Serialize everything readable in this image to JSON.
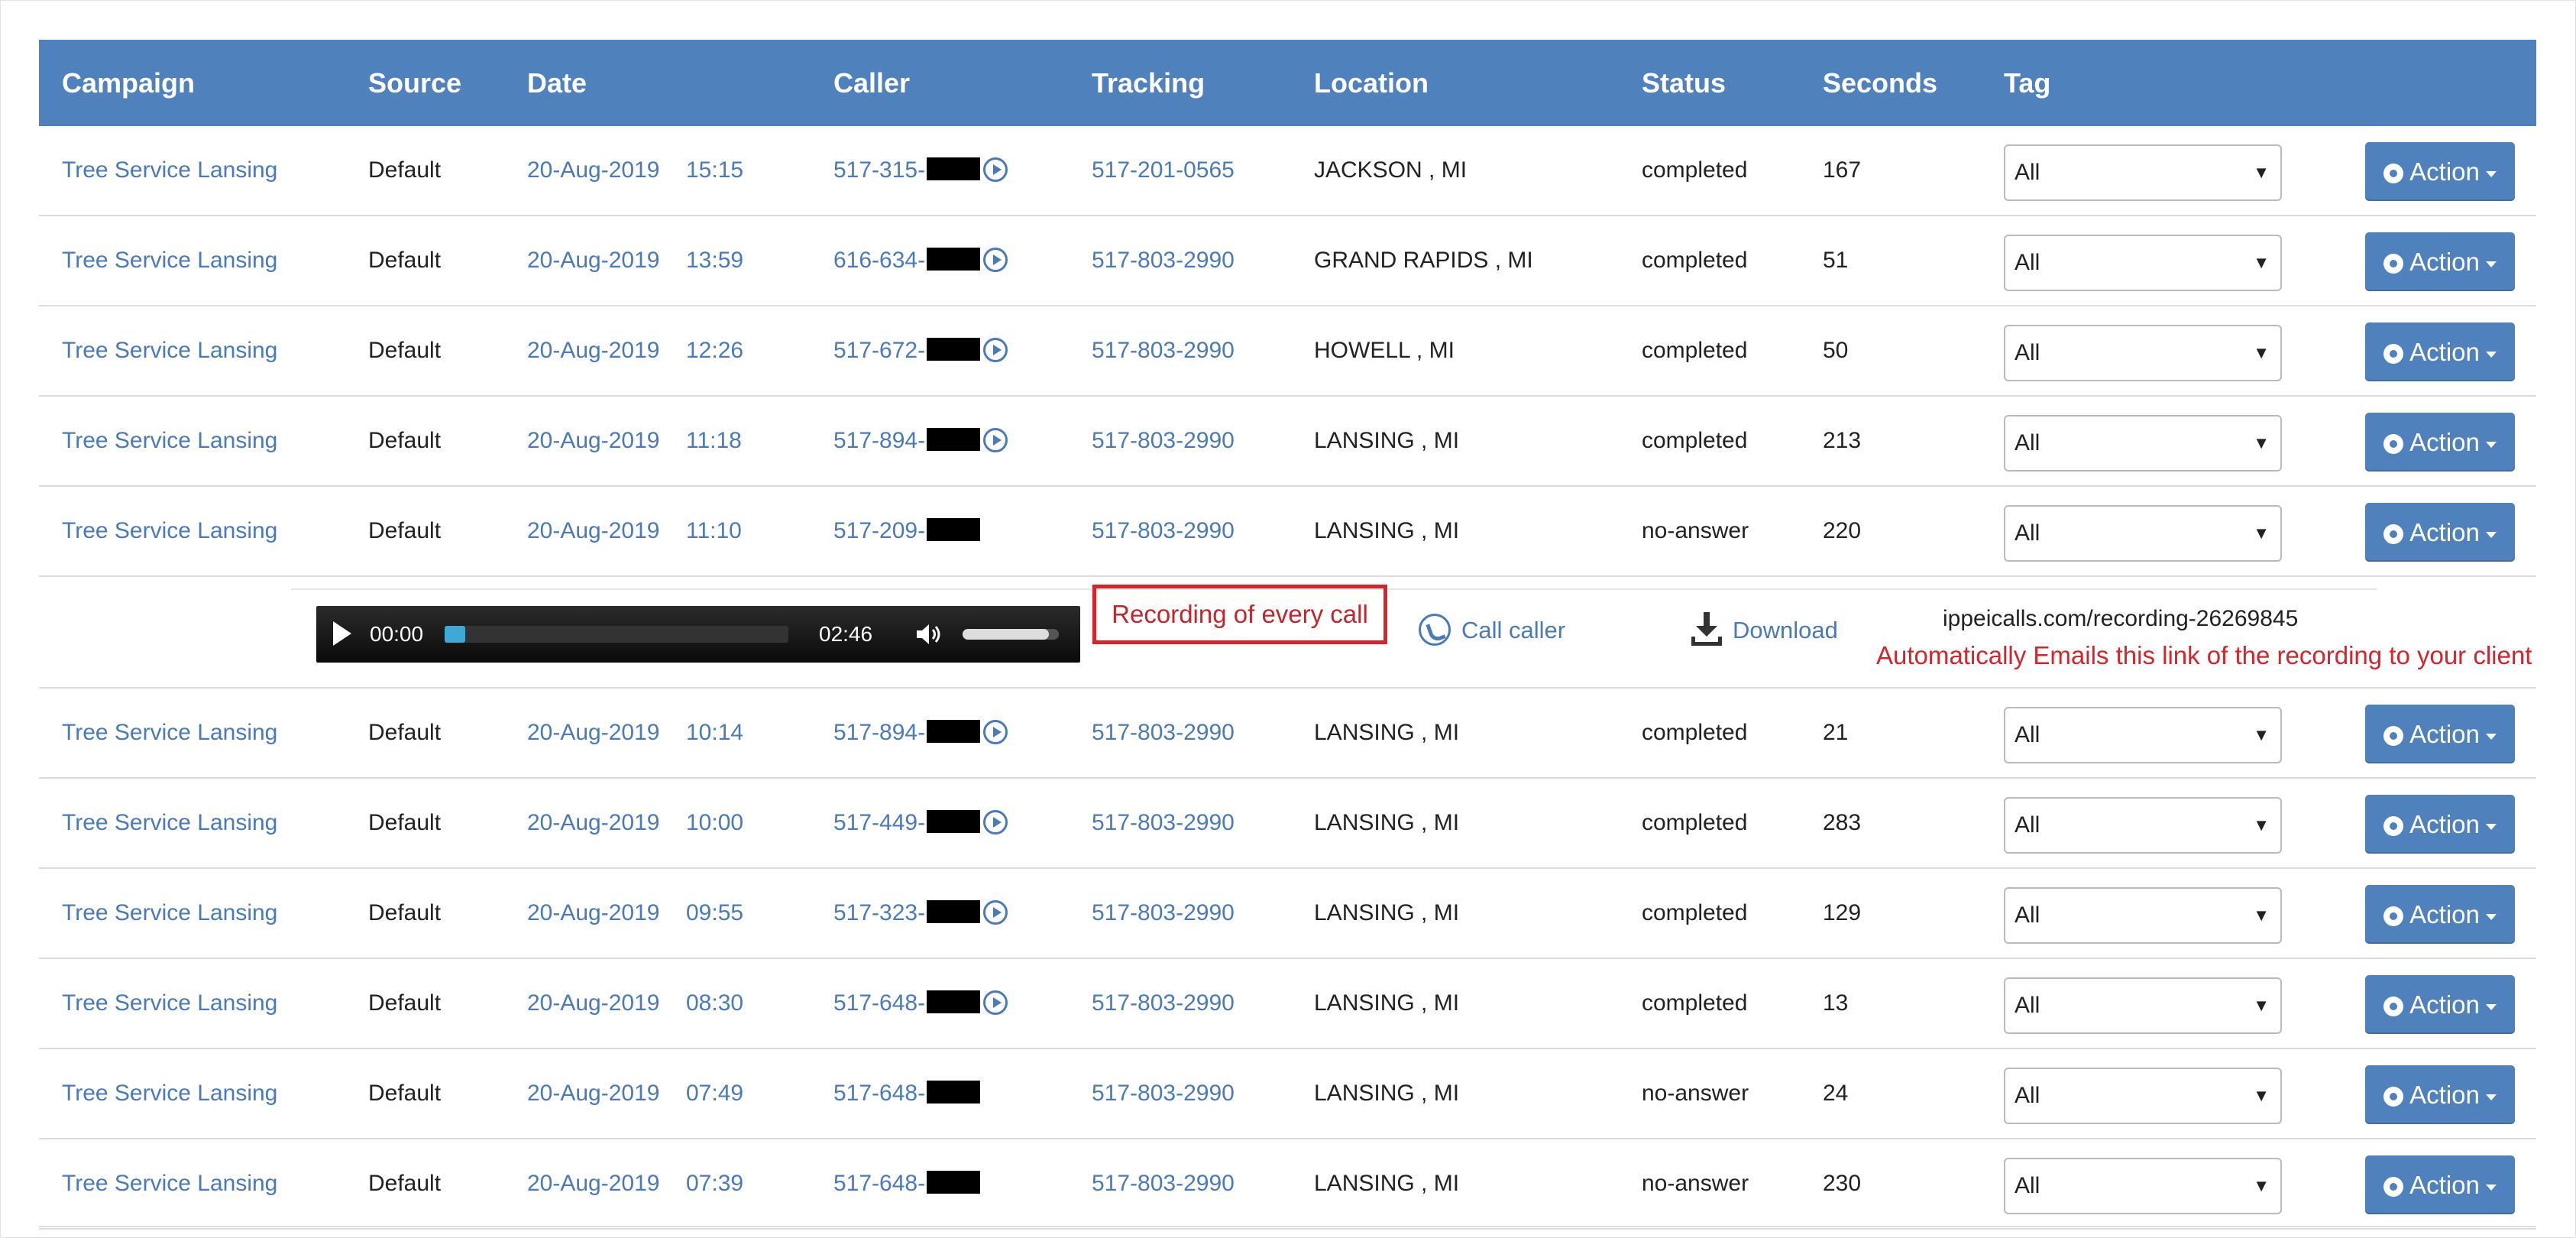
{
  "header": {
    "campaign": "Campaign",
    "source": "Source",
    "date": "Date",
    "caller": "Caller",
    "tracking": "Tracking",
    "location": "Location",
    "status": "Status",
    "seconds": "Seconds",
    "tag": "Tag"
  },
  "rows": [
    {
      "campaign": "Tree Service Lansing",
      "source": "Default",
      "date": "20-Aug-2019",
      "time": "15:15",
      "caller": "517-315-",
      "has_recording": true,
      "tracking": "517-201-0565",
      "location": "JACKSON , MI",
      "status": "completed",
      "seconds": "167",
      "tag": "All",
      "action": "Action"
    },
    {
      "campaign": "Tree Service Lansing",
      "source": "Default",
      "date": "20-Aug-2019",
      "time": "13:59",
      "caller": "616-634-",
      "has_recording": true,
      "tracking": "517-803-2990",
      "location": "GRAND RAPIDS , MI",
      "status": "completed",
      "seconds": "51",
      "tag": "All",
      "action": "Action"
    },
    {
      "campaign": "Tree Service Lansing",
      "source": "Default",
      "date": "20-Aug-2019",
      "time": "12:26",
      "caller": "517-672-",
      "has_recording": true,
      "tracking": "517-803-2990",
      "location": "HOWELL , MI",
      "status": "completed",
      "seconds": "50",
      "tag": "All",
      "action": "Action"
    },
    {
      "campaign": "Tree Service Lansing",
      "source": "Default",
      "date": "20-Aug-2019",
      "time": "11:18",
      "caller": "517-894-",
      "has_recording": true,
      "tracking": "517-803-2990",
      "location": "LANSING , MI",
      "status": "completed",
      "seconds": "213",
      "tag": "All",
      "action": "Action"
    },
    {
      "campaign": "Tree Service Lansing",
      "source": "Default",
      "date": "20-Aug-2019",
      "time": "11:10",
      "caller": "517-209-",
      "has_recording": false,
      "tracking": "517-803-2990",
      "location": "LANSING , MI",
      "status": "no-answer",
      "seconds": "220",
      "tag": "All",
      "action": "Action"
    }
  ],
  "recording": {
    "current_time": "00:00",
    "duration": "02:46",
    "progress": 0.06,
    "volume": 0.9,
    "note": "Recording of every call",
    "call_caller": "Call caller",
    "download": "Download",
    "url": "ippeicalls.com/recording-26269845",
    "auto_note": "Automatically Emails this link of the recording to your client"
  },
  "rows2": [
    {
      "campaign": "Tree Service Lansing",
      "source": "Default",
      "date": "20-Aug-2019",
      "time": "10:14",
      "caller": "517-894-",
      "has_recording": true,
      "tracking": "517-803-2990",
      "location": "LANSING , MI",
      "status": "completed",
      "seconds": "21",
      "tag": "All",
      "action": "Action"
    },
    {
      "campaign": "Tree Service Lansing",
      "source": "Default",
      "date": "20-Aug-2019",
      "time": "10:00",
      "caller": "517-449-",
      "has_recording": true,
      "tracking": "517-803-2990",
      "location": "LANSING , MI",
      "status": "completed",
      "seconds": "283",
      "tag": "All",
      "action": "Action"
    },
    {
      "campaign": "Tree Service Lansing",
      "source": "Default",
      "date": "20-Aug-2019",
      "time": "09:55",
      "caller": "517-323-",
      "has_recording": true,
      "tracking": "517-803-2990",
      "location": "LANSING , MI",
      "status": "completed",
      "seconds": "129",
      "tag": "All",
      "action": "Action"
    },
    {
      "campaign": "Tree Service Lansing",
      "source": "Default",
      "date": "20-Aug-2019",
      "time": "08:30",
      "caller": "517-648-",
      "has_recording": true,
      "tracking": "517-803-2990",
      "location": "LANSING , MI",
      "status": "completed",
      "seconds": "13",
      "tag": "All",
      "action": "Action"
    },
    {
      "campaign": "Tree Service Lansing",
      "source": "Default",
      "date": "20-Aug-2019",
      "time": "07:49",
      "caller": "517-648-",
      "has_recording": false,
      "tracking": "517-803-2990",
      "location": "LANSING , MI",
      "status": "no-answer",
      "seconds": "24",
      "tag": "All",
      "action": "Action"
    },
    {
      "campaign": "Tree Service Lansing",
      "source": "Default",
      "date": "20-Aug-2019",
      "time": "07:39",
      "caller": "517-648-",
      "has_recording": false,
      "tracking": "517-803-2990",
      "location": "LANSING , MI",
      "status": "no-answer",
      "seconds": "230",
      "tag": "All",
      "action": "Action"
    }
  ],
  "colors": {
    "header_bg": "#4f81bd",
    "link": "#4a7ab8",
    "annotation_red": "#d8232a"
  }
}
